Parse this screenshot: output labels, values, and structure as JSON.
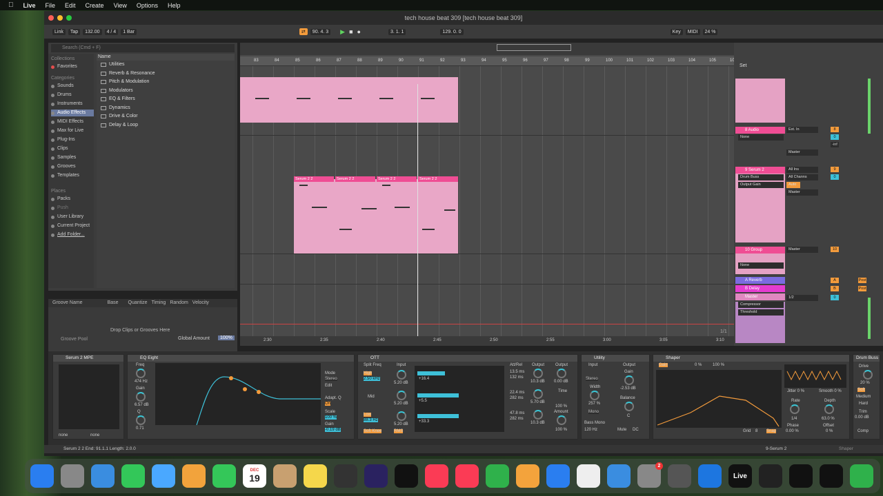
{
  "menubar": {
    "app": "Live",
    "items": [
      "File",
      "Edit",
      "Create",
      "View",
      "Options",
      "Help"
    ]
  },
  "window": {
    "title": "tech house beat 309  [tech house beat 309]"
  },
  "control": {
    "link": "Link",
    "tap": "Tap",
    "tempo": "132.00",
    "sig": "4 / 4",
    "quant": "1 Bar",
    "position": "90.  4.  3",
    "loop_start": "3.  1.  1",
    "loop_len": "129.  0.  0",
    "key": "Key",
    "midi": "MIDI",
    "cpu": "24 %"
  },
  "browser": {
    "search": "Search (Cmd + F)",
    "col_header": "Collections",
    "fav": "Favorites",
    "cat_header": "Categories",
    "categories": [
      "Sounds",
      "Drums",
      "Instruments",
      "Audio Effects",
      "MIDI Effects",
      "Max for Live",
      "Plug-Ins",
      "Clips",
      "Samples",
      "Grooves",
      "Templates"
    ],
    "places_header": "Places",
    "places": [
      "Packs",
      "Push",
      "User Library",
      "Current Project",
      "Add Folder..."
    ],
    "name_header": "Name",
    "names": [
      "Utilities",
      "Reverb & Resonance",
      "Pitch & Modulation",
      "Modulators",
      "EQ & Filters",
      "Dynamics",
      "Drive & Color",
      "Delay & Loop"
    ]
  },
  "groove": {
    "cols": [
      "Groove Name",
      "Base",
      "Quantize",
      "Timing",
      "Random",
      "Velocity"
    ],
    "drop": "Drop Clips or Grooves Here",
    "global_label": "Global Amount",
    "global": "100%",
    "pool": "Groove Pool"
  },
  "ruler": [
    "83",
    "84",
    "85",
    "86",
    "87",
    "88",
    "89",
    "90",
    "91",
    "92",
    "93",
    "94",
    "95",
    "96",
    "97",
    "98",
    "99",
    "100",
    "101",
    "102",
    "103",
    "104",
    "105",
    "106"
  ],
  "timebar": [
    "2:30",
    "2:35",
    "2:40",
    "2:45",
    "2:50",
    "2:55",
    "3:00",
    "3:05",
    "3:10"
  ],
  "page_label": "1/1",
  "clips": {
    "name": "Serum 2 2"
  },
  "tracks": [
    {
      "name": "8 Audio",
      "in": "Ext. In",
      "in2": "None",
      "out": "Master",
      "num": "8"
    },
    {
      "name": "9 Serum 2",
      "in": "All Ins",
      "in2": "Drum Buss",
      "in3": "Output Gain",
      "ch": "All Channs",
      "mon": "Auto",
      "out": "Master",
      "num": "9"
    },
    {
      "name": "10 Group",
      "in2": "None",
      "out": "Master",
      "num": "10"
    },
    {
      "name": "A Reverb",
      "num": "A"
    },
    {
      "name": "B Delay",
      "num": "B"
    },
    {
      "name": "Master",
      "dev": "Compressor",
      "param": "Threshold",
      "out": "1/2"
    }
  ],
  "mixer_misc": {
    "set": "Set",
    "inf": "-inf",
    "zero": "0",
    "c": "C",
    "post": "Post",
    "s": "S"
  },
  "devices": {
    "serum": {
      "title": "Serum 2 MPE",
      "none": "none"
    },
    "eq": {
      "title": "EQ Eight",
      "freq": "Freq",
      "freq_v": "474 Hz",
      "gain": "Gain",
      "gain_v": "6.57 dB",
      "q": "Q",
      "q_v": "0.71",
      "mode": "Mode",
      "mode_v": "Stereo",
      "edit": "Edit",
      "adapt": "Adapt. Q",
      "adapt_v": "On",
      "scale": "Scale",
      "scale_v": "100 %",
      "gain2": "Gain",
      "gain2_v": "-0.19 dB"
    },
    "ott": {
      "title": "OTT",
      "split": "Split Freq",
      "input": "Input",
      "high": "High",
      "high_v": "2.50 kHz",
      "mid": "Mid",
      "low": "Low",
      "low_v": "88.3 Hz",
      "in_db": "5.20 dB",
      "attrel": "Att/Rel",
      "t1": "13.5 ms",
      "t2": "132 ms",
      "t3": "22.4 ms",
      "t4": "282 ms",
      "t5": "47.8 ms",
      "t6": "282 ms",
      "output": "Output",
      "o1": "10.3 dB",
      "o2": "5.70 dB",
      "o3": "10.3 dB",
      "out0": "0.00 dB",
      "time": "Time",
      "time_v": "100 %",
      "amount": "Amount",
      "amount_v": "100 %",
      "soft": "Soft Knee",
      "rms": "RMS",
      "m1": "+16.4",
      "m2": "+5.5",
      "m3": "+33.3"
    },
    "utility": {
      "title": "Utility",
      "input": "Input",
      "output": "Output",
      "width": "Width",
      "width_v": "257 %",
      "gain": "Gain",
      "gain_v": "-2.53 dB",
      "stereo": "Stereo",
      "mono": "Mono",
      "balance": "Balance",
      "c": "C",
      "bassmono": "Bass Mono",
      "bm_v": "120 Hz",
      "mute": "Mute",
      "dc": "DC"
    },
    "shaper": {
      "title": "Shaper",
      "gain": "Gain",
      "pct1": "0 %",
      "pct2": "100 %",
      "jitter": "Jitter 0 %",
      "smooth": "Smooth 0 %",
      "rate": "Rate",
      "rate_v": "1/4",
      "phase": "Phase",
      "phase_v": "0.00 %",
      "depth": "Depth",
      "depth_v": "63.0 %",
      "offset": "Offset",
      "offset_v": "0 %",
      "grid": "Grid",
      "grid_v": "8",
      "snap": "Snap"
    },
    "drum": {
      "title": "Drum Buss",
      "drive": "Drive",
      "drive_v": "20 %",
      "soft": "Soft",
      "medium": "Medium",
      "hard": "Hard",
      "trim": "Trim",
      "trim_v": "0.00 dB",
      "comp": "Comp"
    }
  },
  "status": {
    "text": "Serum 2 2  End: 91.1.1  Length: 2.0.0",
    "track": "9-Serum 2",
    "shaper": "Shaper"
  },
  "dock": [
    "Finder",
    "Launchpad",
    "Safari",
    "Messages",
    "Maps",
    "Photos",
    "FaceTime",
    "Calendar",
    "Contacts",
    "Notes",
    "Freeform",
    "Premiere",
    "TV",
    "Music",
    "News",
    "Numbers",
    "Pages",
    "App Store",
    "Reminders",
    "Mail",
    "Settings",
    "Screenshot",
    "Keynote",
    "Live",
    "Activity",
    "Capcut",
    "Waves",
    "WhatsApp"
  ],
  "dock_date": {
    "month": "DEC",
    "day": "19"
  },
  "dock_badge": "2"
}
